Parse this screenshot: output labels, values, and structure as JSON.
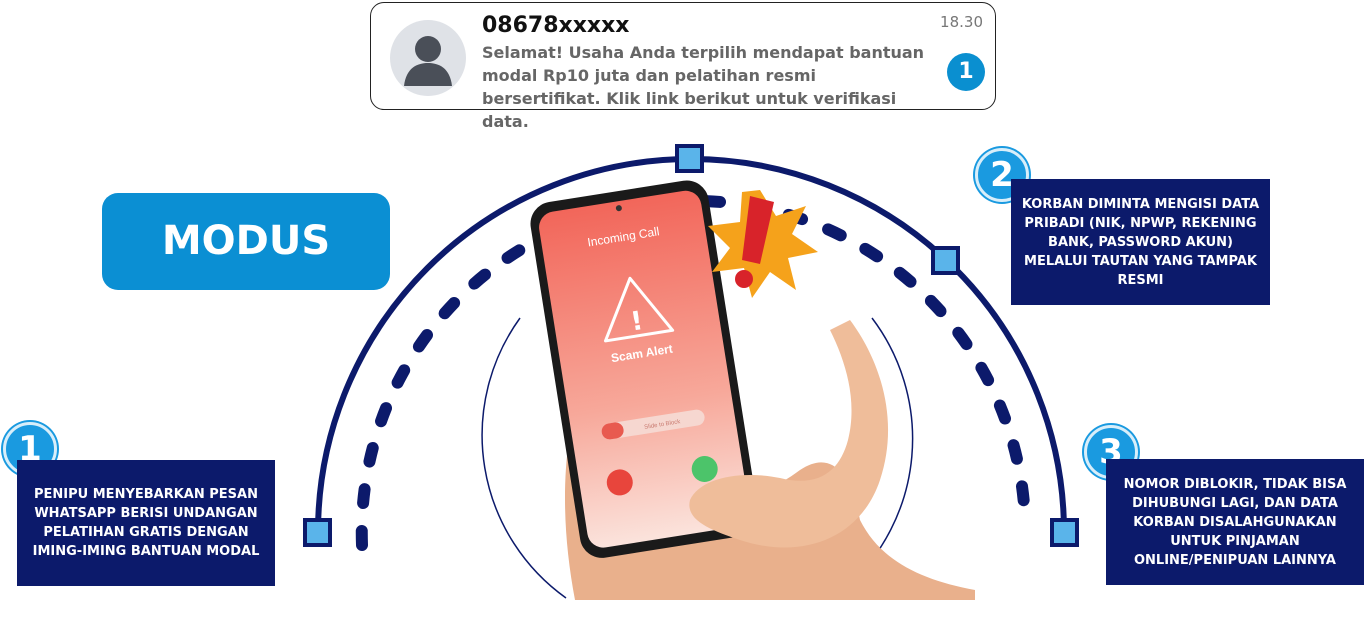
{
  "notification": {
    "sender": "08678xxxxx",
    "time": "18.30",
    "message": "Selamat! Usaha Anda terpilih mendapat bantuan modal Rp10 juta dan pelatihan resmi bersertifikat. Klik link berikut untuk verifikasi data.",
    "badge": "1",
    "avatar_icon": "user-avatar-icon"
  },
  "title": "MODUS",
  "phone": {
    "screen_title": "Incoming Call",
    "alert_text": "Scam Alert",
    "slider_text": "Slide to Block"
  },
  "steps": [
    {
      "number": "1",
      "text": "PENIPU MENYEBARKAN PESAN WHATSAPP BERISI UNDANGAN PELATIHAN GRATIS DENGAN IMING-IMING BANTUAN MODAL"
    },
    {
      "number": "2",
      "text": "KORBAN DIMINTA MENGISI DATA PRIBADI (NIK, NPWP, REKENING BANK, PASSWORD AKUN) MELALUI TAUTAN YANG TAMPAK RESMI"
    },
    {
      "number": "3",
      "text": "NOMOR DIBLOKIR, TIDAK BISA DIHUBUNGI LAGI, DAN DATA KORBAN DISALAHGUNAKAN UNTUK PINJAMAN ONLINE/PENIPUAN LAINNYA"
    }
  ],
  "colors": {
    "navy": "#0c1a6b",
    "blue": "#0b8fd3",
    "light_blue": "#5ab4ea",
    "warning_orange": "#f5a21b",
    "warning_red": "#d8232a"
  }
}
